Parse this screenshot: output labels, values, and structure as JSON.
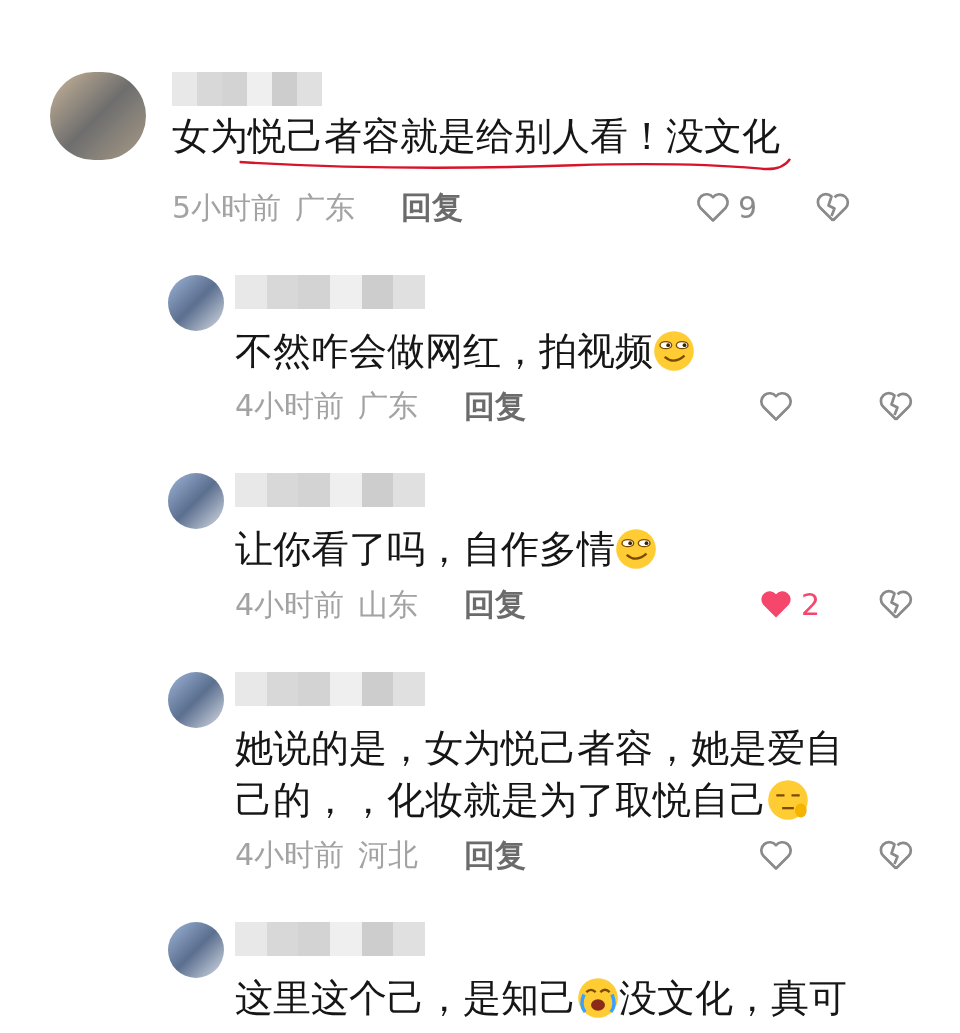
{
  "comments": [
    {
      "kind": "top",
      "underlined": true,
      "body": [
        {
          "kind": "text",
          "text": "女为悦己者容就是给别人看！没文化"
        }
      ],
      "time": "5小时前",
      "region": "广东",
      "reply": "回复",
      "liked": false,
      "likes": "9"
    },
    {
      "kind": "reply",
      "underlined": false,
      "body": [
        {
          "kind": "text",
          "text": "不然咋会做网红，拍视频"
        },
        {
          "kind": "smirk"
        }
      ],
      "time": "4小时前",
      "region": "广东",
      "reply": "回复",
      "liked": false
    },
    {
      "kind": "reply",
      "underlined": false,
      "body": [
        {
          "kind": "text",
          "text": "让你看了吗，自作多情"
        },
        {
          "kind": "smirk"
        }
      ],
      "time": "4小时前",
      "region": "山东",
      "reply": "回复",
      "liked": true,
      "likes": "2"
    },
    {
      "kind": "reply",
      "underlined": false,
      "body": [
        {
          "kind": "text",
          "text": "她说的是，女为悦己者容，她是爱自己的，，化妆就是为了取悦自己"
        },
        {
          "kind": "pensive"
        }
      ],
      "time": "4小时前",
      "region": "河北",
      "reply": "回复",
      "liked": false
    },
    {
      "kind": "reply",
      "underlined": false,
      "body": [
        {
          "kind": "text",
          "text": "这里这个己，是知己"
        },
        {
          "kind": "crying"
        },
        {
          "kind": "text",
          "text": "没文化，真可"
        }
      ]
    }
  ]
}
